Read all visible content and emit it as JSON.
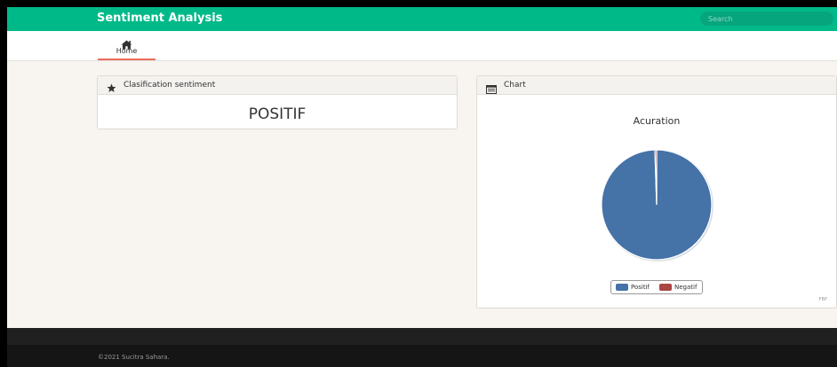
{
  "app": {
    "brand": "Sentiment Analysis",
    "search": {
      "placeholder": "Search",
      "value": ""
    }
  },
  "nav": {
    "items": [
      {
        "label": "Home",
        "icon": "home-icon",
        "active": true
      }
    ]
  },
  "classification_panel": {
    "title": "Clasification sentiment",
    "icon": "star-icon",
    "result": "POSITIF"
  },
  "chart_panel": {
    "title": "Chart",
    "icon": "chart-icon"
  },
  "chart_data": {
    "type": "pie",
    "title": "Acuration",
    "categories": [
      "Positif",
      "Negatif"
    ],
    "values": [
      99.5,
      0.5
    ],
    "colors": [
      "#4572a7",
      "#aa4643"
    ],
    "legend_position": "bottom-center",
    "credits": "FBP"
  },
  "footer": {
    "copyright": "©2021 Sucitra Sahara."
  },
  "colors": {
    "brand_green": "#00b989",
    "active_tab_underline": "#ed6b5c",
    "footer_dark": "#151515"
  }
}
